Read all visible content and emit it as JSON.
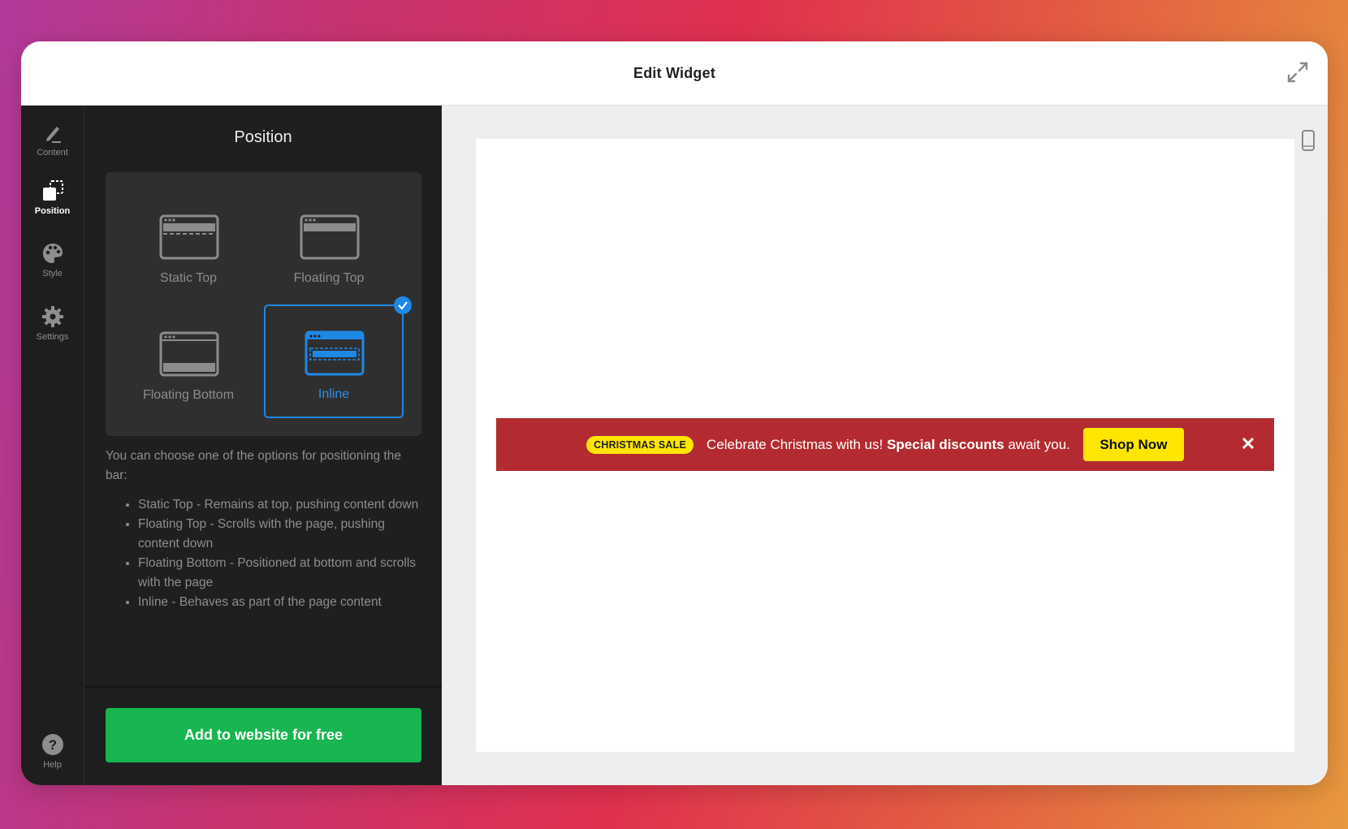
{
  "window": {
    "title": "Edit Widget",
    "expand_icon": "expand-arrows-icon"
  },
  "sidebar": {
    "items": [
      {
        "label": "Content",
        "icon": "pencil-icon",
        "active": false
      },
      {
        "label": "Position",
        "icon": "position-icon",
        "active": true
      },
      {
        "label": "Style",
        "icon": "palette-icon",
        "active": false
      },
      {
        "label": "Settings",
        "icon": "gear-icon",
        "active": false
      }
    ],
    "help": {
      "label": "Help",
      "icon": "help-icon"
    }
  },
  "panel": {
    "title": "Position",
    "options": [
      {
        "label": "Static Top",
        "selected": false
      },
      {
        "label": "Floating Top",
        "selected": false
      },
      {
        "label": "Floating Bottom",
        "selected": false
      },
      {
        "label": "Inline",
        "selected": true
      }
    ],
    "description": "You can choose one of the options for positioning the bar:",
    "bullets": [
      "Static Top - Remains at top, pushing content down",
      "Floating Top - Scrolls with the page, pushing content down",
      "Floating Bottom - Positioned at bottom and scrolls with the page",
      "Inline - Behaves as part of the page content"
    ],
    "cta_label": "Add to website for free"
  },
  "preview": {
    "device_icon": "mobile-device-icon",
    "banner": {
      "badge": "CHRISTMAS SALE",
      "text_start": "Celebrate Christmas with us! ",
      "text_bold": "Special discounts",
      "text_end": " await you.",
      "button_label": "Shop Now",
      "close_symbol": "✕",
      "background_color": "#b32b30",
      "accent_color": "#ffe600"
    }
  },
  "colors": {
    "selected_accent": "#1e88e5",
    "cta_green": "#17b650"
  }
}
